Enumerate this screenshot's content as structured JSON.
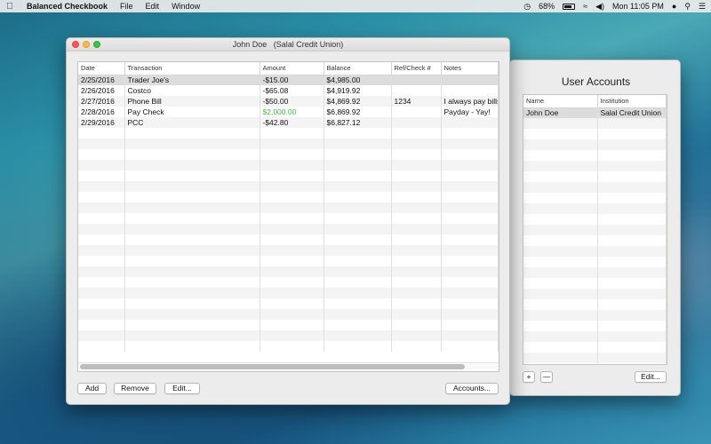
{
  "menubar": {
    "app_name": "Balanced Checkbook",
    "menus": [
      "File",
      "Edit",
      "Window"
    ],
    "battery": "68%",
    "clock": "Mon 11:05 PM"
  },
  "main_window": {
    "title": "John Doe   (Salal Credit Union)",
    "columns": [
      "Date",
      "Transaction",
      "Amount",
      "Balance",
      "Ref/Check #",
      "Notes"
    ],
    "rows": [
      {
        "date": "2/25/2016",
        "transaction": "Trader Joe's",
        "amount": "-$15.00",
        "balance": "$4,985.00",
        "ref": "",
        "notes": ""
      },
      {
        "date": "2/26/2016",
        "transaction": "Costco",
        "amount": "-$65.08",
        "balance": "$4,919.92",
        "ref": "",
        "notes": ""
      },
      {
        "date": "2/27/2016",
        "transaction": "Phone Bill",
        "amount": "-$50.00",
        "balance": "$4,869.92",
        "ref": "1234",
        "notes": "I always pay bills"
      },
      {
        "date": "2/28/2016",
        "transaction": "Pay Check",
        "amount": "$2,000.00",
        "balance": "$6,869.92",
        "ref": "",
        "notes": "Payday - Yay!"
      },
      {
        "date": "2/29/2016",
        "transaction": "PCC",
        "amount": "-$42.80",
        "balance": "$6,827.12",
        "ref": "",
        "notes": ""
      }
    ],
    "buttons": {
      "add": "Add",
      "remove": "Remove",
      "edit": "Edit...",
      "accounts": "Accounts..."
    },
    "positive_color": "#3ec23e"
  },
  "accounts_window": {
    "title": "User Accounts",
    "columns": [
      "Name",
      "Institution"
    ],
    "rows": [
      {
        "name": "John Doe",
        "institution": "Salal Credit Union"
      }
    ],
    "buttons": {
      "add": "+",
      "remove": "—",
      "edit": "Edit..."
    }
  }
}
